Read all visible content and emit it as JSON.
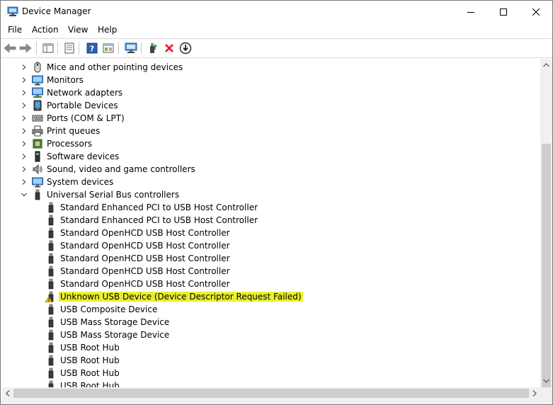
{
  "window": {
    "title": "Device Manager"
  },
  "menu": {
    "items": [
      "File",
      "Action",
      "View",
      "Help"
    ]
  },
  "toolbar": {
    "buttons": [
      {
        "icon": "back-arrow-icon"
      },
      {
        "icon": "forward-arrow-icon"
      },
      {
        "icon": "show-hide-console-tree-icon"
      },
      {
        "icon": "properties-icon"
      },
      {
        "icon": "help-icon"
      },
      {
        "icon": "show-hidden-devices-icon"
      },
      {
        "icon": "scan-hardware-changes-icon"
      },
      {
        "icon": "update-driver-icon"
      },
      {
        "icon": "uninstall-device-icon"
      },
      {
        "icon": "disable-device-icon"
      }
    ]
  },
  "tree": {
    "rows": [
      {
        "label": "Mice and other pointing devices",
        "level": 1,
        "expanded": false,
        "icon": "mouse-icon"
      },
      {
        "label": "Monitors",
        "level": 1,
        "expanded": false,
        "icon": "monitor-icon"
      },
      {
        "label": "Network adapters",
        "level": 1,
        "expanded": false,
        "icon": "network-adapter-icon"
      },
      {
        "label": "Portable Devices",
        "level": 1,
        "expanded": false,
        "icon": "portable-device-icon"
      },
      {
        "label": "Ports (COM & LPT)",
        "level": 1,
        "expanded": false,
        "icon": "port-icon"
      },
      {
        "label": "Print queues",
        "level": 1,
        "expanded": false,
        "icon": "printer-icon"
      },
      {
        "label": "Processors",
        "level": 1,
        "expanded": false,
        "icon": "processor-icon"
      },
      {
        "label": "Software devices",
        "level": 1,
        "expanded": false,
        "icon": "software-device-icon"
      },
      {
        "label": "Sound, video and game controllers",
        "level": 1,
        "expanded": false,
        "icon": "speaker-icon"
      },
      {
        "label": "System devices",
        "level": 1,
        "expanded": false,
        "icon": "system-device-icon"
      },
      {
        "label": "Universal Serial Bus controllers",
        "level": 1,
        "expanded": true,
        "icon": "usb-plug-icon"
      },
      {
        "label": "Standard Enhanced PCI to USB Host Controller",
        "level": 2,
        "icon": "usb-plug-icon"
      },
      {
        "label": "Standard Enhanced PCI to USB Host Controller",
        "level": 2,
        "icon": "usb-plug-icon"
      },
      {
        "label": "Standard OpenHCD USB Host Controller",
        "level": 2,
        "icon": "usb-plug-icon"
      },
      {
        "label": "Standard OpenHCD USB Host Controller",
        "level": 2,
        "icon": "usb-plug-icon"
      },
      {
        "label": "Standard OpenHCD USB Host Controller",
        "level": 2,
        "icon": "usb-plug-icon"
      },
      {
        "label": "Standard OpenHCD USB Host Controller",
        "level": 2,
        "icon": "usb-plug-icon"
      },
      {
        "label": "Standard OpenHCD USB Host Controller",
        "level": 2,
        "icon": "usb-plug-icon"
      },
      {
        "label": "Unknown USB Device (Device Descriptor Request Failed)",
        "level": 2,
        "icon": "usb-warning-icon",
        "highlight": true
      },
      {
        "label": "USB Composite Device",
        "level": 2,
        "icon": "usb-plug-icon"
      },
      {
        "label": "USB Mass Storage Device",
        "level": 2,
        "icon": "usb-plug-icon"
      },
      {
        "label": "USB Mass Storage Device",
        "level": 2,
        "icon": "usb-plug-icon"
      },
      {
        "label": "USB Root Hub",
        "level": 2,
        "icon": "usb-plug-icon"
      },
      {
        "label": "USB Root Hub",
        "level": 2,
        "icon": "usb-plug-icon"
      },
      {
        "label": "USB Root Hub",
        "level": 2,
        "icon": "usb-plug-icon"
      },
      {
        "label": "USB Root Hub",
        "level": 2,
        "icon": "usb-plug-icon"
      }
    ]
  },
  "colors": {
    "highlight": "#e7f12e",
    "uninstall_red": "#e81123",
    "help_blue": "#2b5fb5",
    "warning_yellow": "#f5c400"
  }
}
